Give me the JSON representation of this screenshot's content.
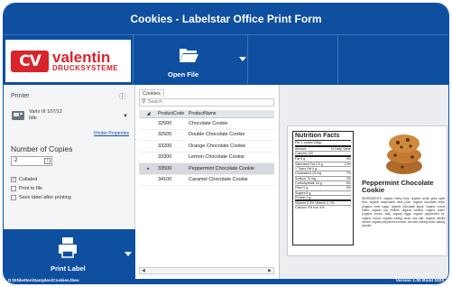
{
  "window": {
    "title": "Cookies - Labelstar Office Print Form"
  },
  "brand": {
    "mark": "CV",
    "name": "valentin",
    "sub": "DRUCKSYSTEME",
    "color": "#d8242a"
  },
  "toolbar": {
    "open_label": "Open File",
    "accent": "#0e4fa0"
  },
  "printer": {
    "section_label": "Printer",
    "name": "Vario III 107/12",
    "status": "Idle",
    "properties_link": "Printer Properties"
  },
  "copies": {
    "label": "Number of Copies",
    "value": "2"
  },
  "options": {
    "collated": "Collated",
    "print_to_file": "Print to file",
    "save_after": "Save label after printing"
  },
  "print_button": {
    "label": "Print Label"
  },
  "grid": {
    "tab": "Cookies",
    "search_placeholder": "Search",
    "col_code": "ProductCode",
    "col_name": "ProductName",
    "rows": [
      {
        "code": "32500",
        "name": "Chocolate Cookie"
      },
      {
        "code": "32505",
        "name": "Double Chocolate Cookie"
      },
      {
        "code": "33200",
        "name": "Orange Chocolate Cookie"
      },
      {
        "code": "33300",
        "name": "Lemon Chocolate Cookie"
      },
      {
        "code": "33500",
        "name": "Peppermint Chocolate Cookie"
      },
      {
        "code": "34100",
        "name": "Caramel Chocolate Cookie"
      }
    ],
    "selected_index": 4
  },
  "label_preview": {
    "nutrition_title": "Nutrition Facts",
    "serving": "Per 1 cookie (28g)",
    "amount_head": "Amount",
    "dv_head": "% Daily Value",
    "calories": "Calories 120",
    "fat": "Fat 6 g",
    "fat_dv": "9%",
    "sat_fat": "Saturated Fat 2.5 g",
    "sat_fat_dv": "13%",
    "trans_fat": "+ Trans Fat 0 g",
    "cholesterol": "Cholesterol 25 mg",
    "cholesterol_dv": "7%",
    "sodium": "Sodium 70 mg",
    "sodium_dv": "3%",
    "carbs": "Carbohydrate 16 g",
    "carbs_dv": "5%",
    "fibre": "Fibre 0 g",
    "fibre_dv": "0%",
    "sugars": "Sugars 8 g",
    "protein": "Protein 2 g",
    "vitamins": "Vitamin A 4%   Vitamin C 0%",
    "minerals": "Calcium 0%   Iron 4%",
    "product_title": "Peppermint Chocolate Cookie",
    "ingredients": "INGREDIENTS: organic celery flour, organic whole grain spelt flour, organic evaporated cane juice, organic chocolate chips (organic cane sugar, organic chocolate liquor, organic cocoa butter, organic soy lecithin, organic vanilla), organic butter (organic cream, salt), organic eggs, organic peppermint oil, organic cocoa, organic baking soda, sea salt, organic vanilla extract, organic peppermint extract, sea salt, baking soda, baking powder."
  },
  "status": {
    "path": "D:\\Etiketten\\Samples\\Cookies.lbex",
    "version": "Version 1.00 Build 1020"
  }
}
